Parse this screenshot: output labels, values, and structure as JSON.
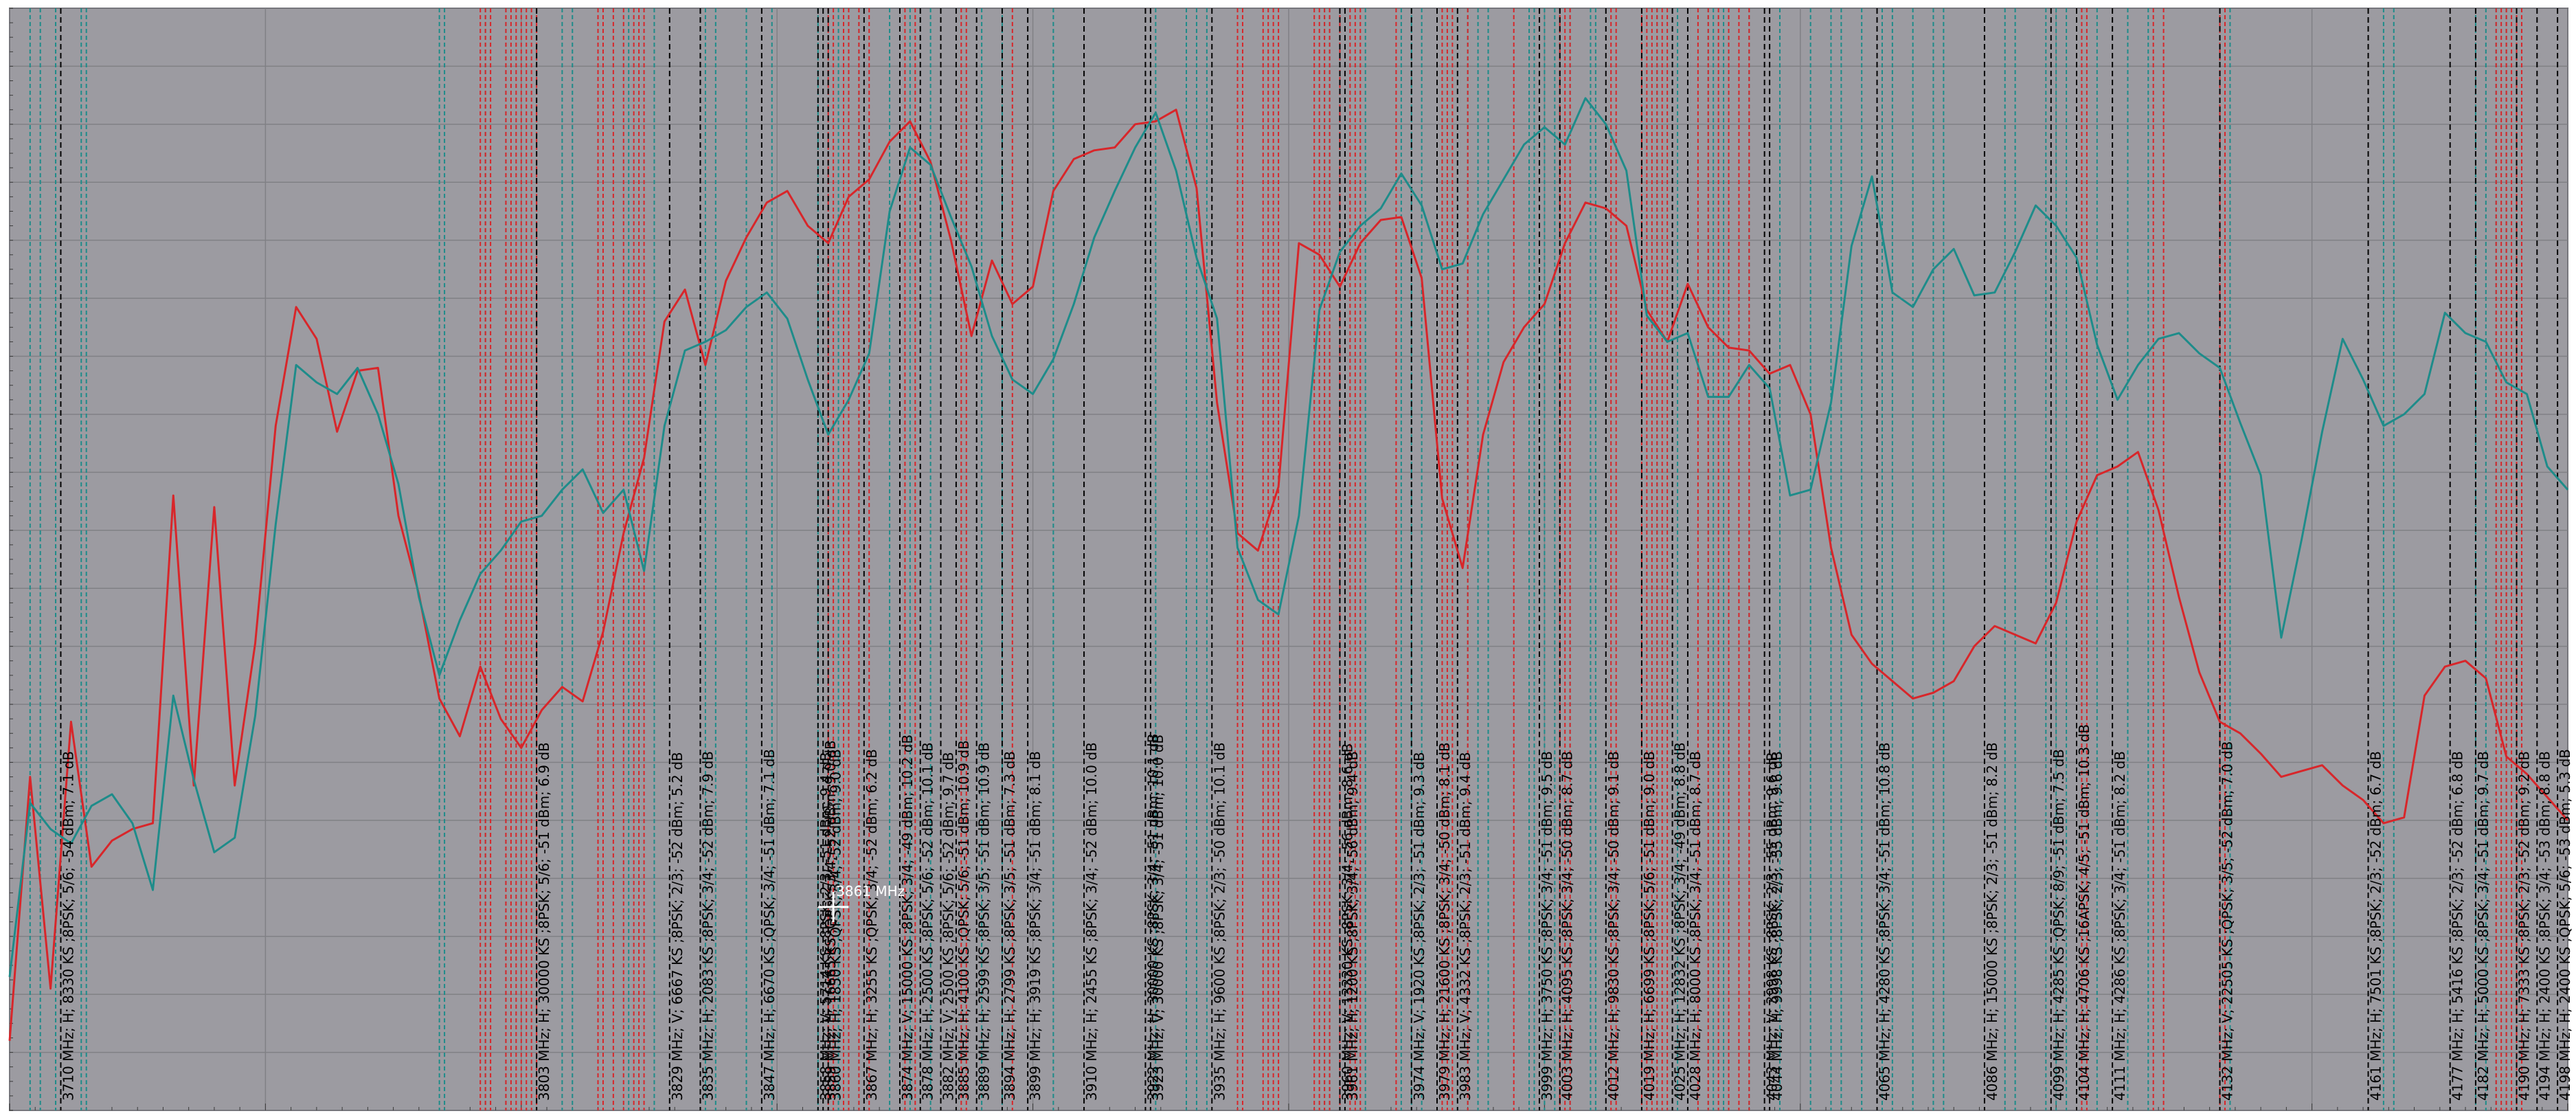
{
  "chart_data": {
    "type": "line",
    "title": "",
    "xlabel": "",
    "ylabel": "",
    "xlim": [
      3700,
      4200
    ],
    "ylim": [
      -82,
      -44
    ],
    "grid": true,
    "cursor": {
      "label": "3861 MHz",
      "freq": 3861
    },
    "colors": {
      "background": "#9c9ba1",
      "grid": "#808085",
      "series_h": "#d8262a",
      "series_v": "#1e8c8a",
      "marker_label": "#000000"
    },
    "series": [
      {
        "name": "",
        "color": "#d8262a",
        "x": [
          3700,
          3704,
          3708,
          3712,
          3716,
          3720,
          3724,
          3728,
          3732,
          3736,
          3740,
          3744,
          3748,
          3752,
          3756,
          3760,
          3764,
          3768,
          3772,
          3776,
          3780,
          3784,
          3788,
          3792,
          3796,
          3800,
          3804,
          3808,
          3812,
          3816,
          3820,
          3824,
          3828,
          3832,
          3836,
          3840,
          3844,
          3848,
          3852,
          3856,
          3860,
          3864,
          3868,
          3872,
          3876,
          3880,
          3884,
          3888,
          3892,
          3896,
          3900,
          3904,
          3908,
          3912,
          3916,
          3920,
          3924,
          3928,
          3932,
          3936,
          3940,
          3944,
          3948,
          3952,
          3956,
          3960,
          3964,
          3968,
          3972,
          3976,
          3980,
          3984,
          3988,
          3992,
          3996,
          4000,
          4004,
          4008,
          4012,
          4016,
          4020,
          4024,
          4028,
          4032,
          4036,
          4040,
          4044,
          4048,
          4052,
          4056,
          4060,
          4064,
          4068,
          4072,
          4076,
          4080,
          4084,
          4088,
          4092,
          4096,
          4100,
          4104,
          4108,
          4112,
          4116,
          4120,
          4124,
          4128,
          4132,
          4136,
          4140,
          4144,
          4148,
          4152,
          4156,
          4160,
          4164,
          4168,
          4172,
          4176,
          4180,
          4184,
          4188,
          4192,
          4196,
          4200
        ],
        "y": [
          -79.6,
          -70.5,
          -77.8,
          -68.6,
          -73.6,
          -72.7,
          -72.3,
          -72.1,
          -60.8,
          -70.8,
          -61.2,
          -70.8,
          -65.9,
          -58.4,
          -54.3,
          -55.4,
          -58.6,
          -56.5,
          -56.4,
          -61.5,
          -64.2,
          -67.8,
          -69.1,
          -66.7,
          -68.5,
          -69.5,
          -68.2,
          -67.4,
          -67.9,
          -65.5,
          -62.1,
          -59.5,
          -54.8,
          -53.7,
          -56.3,
          -53.4,
          -51.9,
          -50.7,
          -50.3,
          -51.5,
          -52.1,
          -50.5,
          -49.9,
          -48.6,
          -47.9,
          -49.3,
          -52.0,
          -55.3,
          -52.7,
          -54.2,
          -53.6,
          -50.3,
          -49.2,
          -48.9,
          -48.8,
          -48.0,
          -47.9,
          -47.5,
          -50.2,
          -57.6,
          -62.1,
          -62.7,
          -60.5,
          -52.1,
          -52.5,
          -53.6,
          -52.1,
          -51.3,
          -51.2,
          -53.3,
          -60.9,
          -63.3,
          -58.7,
          -56.2,
          -55.0,
          -54.2,
          -52.1,
          -50.7,
          -50.9,
          -51.5,
          -54.4,
          -55.5,
          -53.5,
          -55.0,
          -55.7,
          -55.8,
          -56.6,
          -56.3,
          -58.0,
          -62.6,
          -65.6,
          -66.6,
          -67.2,
          -67.8,
          -67.6,
          -67.2,
          -66.0,
          -65.3,
          -65.6,
          -65.9,
          -64.5,
          -61.7,
          -60.1,
          -59.8,
          -59.3,
          -61.3,
          -64.3,
          -66.9,
          -68.6,
          -69.0,
          -69.7,
          -70.5,
          -70.3,
          -70.1,
          -70.8,
          -71.3,
          -72.1,
          -71.9,
          -67.7,
          -66.7,
          -66.5,
          -67.1,
          -69.8,
          -70.4,
          -71.2,
          -72.0
        ]
      },
      {
        "name": "",
        "color": "#1e8c8a",
        "x": [
          3700,
          3704,
          3708,
          3712,
          3716,
          3720,
          3724,
          3728,
          3732,
          3736,
          3740,
          3744,
          3748,
          3752,
          3756,
          3760,
          3764,
          3768,
          3772,
          3776,
          3780,
          3784,
          3788,
          3792,
          3796,
          3800,
          3804,
          3808,
          3812,
          3816,
          3820,
          3824,
          3828,
          3832,
          3836,
          3840,
          3844,
          3848,
          3852,
          3856,
          3860,
          3864,
          3868,
          3872,
          3876,
          3880,
          3884,
          3888,
          3892,
          3896,
          3900,
          3904,
          3908,
          3912,
          3916,
          3920,
          3924,
          3928,
          3932,
          3936,
          3940,
          3944,
          3948,
          3952,
          3956,
          3960,
          3964,
          3968,
          3972,
          3976,
          3980,
          3984,
          3988,
          3992,
          3996,
          4000,
          4004,
          4008,
          4012,
          4016,
          4020,
          4024,
          4028,
          4032,
          4036,
          4040,
          4044,
          4048,
          4052,
          4056,
          4060,
          4064,
          4068,
          4072,
          4076,
          4080,
          4084,
          4088,
          4092,
          4096,
          4100,
          4104,
          4108,
          4112,
          4116,
          4120,
          4124,
          4128,
          4132,
          4136,
          4140,
          4144,
          4148,
          4152,
          4156,
          4160,
          4164,
          4168,
          4172,
          4176,
          4180,
          4184,
          4188,
          4192,
          4196,
          4200
        ],
        "y": [
          -77.4,
          -71.4,
          -72.3,
          -72.8,
          -71.5,
          -71.1,
          -72.1,
          -74.4,
          -67.7,
          -70.6,
          -73.1,
          -72.6,
          -68.4,
          -61.8,
          -56.3,
          -56.9,
          -57.3,
          -56.4,
          -58.0,
          -60.4,
          -64.3,
          -67.0,
          -65.1,
          -63.5,
          -62.7,
          -61.7,
          -61.5,
          -60.6,
          -59.9,
          -61.4,
          -60.6,
          -63.4,
          -58.4,
          -55.8,
          -55.5,
          -55.1,
          -54.3,
          -53.8,
          -54.7,
          -56.8,
          -58.7,
          -57.5,
          -55.9,
          -51.0,
          -48.8,
          -49.4,
          -51.2,
          -52.9,
          -55.3,
          -56.8,
          -57.3,
          -56.1,
          -54.2,
          -51.9,
          -50.3,
          -48.8,
          -47.6,
          -49.6,
          -52.6,
          -54.7,
          -62.6,
          -64.4,
          -64.9,
          -61.5,
          -54.4,
          -52.4,
          -51.5,
          -50.9,
          -49.7,
          -50.8,
          -53.0,
          -52.8,
          -51.1,
          -49.9,
          -48.7,
          -48.1,
          -48.7,
          -47.1,
          -48.0,
          -49.6,
          -54.6,
          -55.5,
          -55.2,
          -57.4,
          -57.4,
          -56.3,
          -57.1,
          -60.8,
          -60.6,
          -57.6,
          -52.2,
          -49.8,
          -53.8,
          -54.3,
          -53.0,
          -52.3,
          -53.9,
          -53.8,
          -52.4,
          -50.8,
          -51.5,
          -52.6,
          -55.6,
          -57.5,
          -56.3,
          -55.4,
          -55.2,
          -55.9,
          -56.4,
          -58.3,
          -60.1,
          -65.7,
          -62.3,
          -58.6,
          -55.4,
          -56.8,
          -58.4,
          -58.0,
          -57.3,
          -54.5,
          -55.2,
          -55.5,
          -56.9,
          -57.3,
          -59.8,
          -60.6
        ]
      }
    ],
    "markers": [
      {
        "freq": 3710,
        "pol": "H",
        "label": "3710 MHz; H; 8330 KS ;8PSK; 5/6; -54 dBm; 7.1 dB"
      },
      {
        "freq": 3803,
        "pol": "H",
        "label": "3803 MHz; H; 30000 KS ;8PSK; 5/6; -51 dBm; 6.9 dB"
      },
      {
        "freq": 3829,
        "pol": "V",
        "label": "3829 MHz; V; 6667 KS ;8PSK; 2/3; -52 dBm; 5.2 dB"
      },
      {
        "freq": 3835,
        "pol": "H",
        "label": "3835 MHz; H; 2083 KS ;8PSK; 3/4; -52 dBm; 7.9 dB"
      },
      {
        "freq": 3847,
        "pol": "H",
        "label": "3847 MHz; H; 6670 KS ;QPSK; 3/4; -51 dBm; 7.1 dB"
      },
      {
        "freq": 3858,
        "pol": "V",
        "label": "3858 MHz; V; 5714 KS ;8PSK; 2/3; -51 dBm; 9.4 dB"
      },
      {
        "freq": 3859,
        "pol": "H",
        "label": "3859 MHz; H; 16665 KS ;QPSK; 3/4; -52 dBm; 9.0 dB"
      },
      {
        "freq": 3860,
        "pol": "H",
        "label": "3860 MHz; H; 1850 KS ;QPSK; 3/4; -52 dBm; 9.0 dB"
      },
      {
        "freq": 3867,
        "pol": "H",
        "label": "3867 MHz; H; 3255 KS ;QPSK; 3/4; -52 dBm; 6.2 dB"
      },
      {
        "freq": 3874,
        "pol": "V",
        "label": "3874 MHz; V; 15000 KS ;8PSK; 3/4; -49 dBm; 10.2 dB"
      },
      {
        "freq": 3878,
        "pol": "H",
        "label": "3878 MHz; H; 2500 KS ;8PSK; 5/6; -52 dBm; 10.1 dB"
      },
      {
        "freq": 3882,
        "pol": "V",
        "label": "3882 MHz; V; 2500 KS ;8PSK; 5/6; -52 dBm; 9.7 dB"
      },
      {
        "freq": 3885,
        "pol": "H",
        "label": "3885 MHz; H; 4100 KS ;QPSK; 5/6; -51 dBm; 10.9 dB"
      },
      {
        "freq": 3889,
        "pol": "H",
        "label": "3889 MHz; H; 2599 KS ;8PSK; 3/5; -51 dBm; 10.9 dB"
      },
      {
        "freq": 3894,
        "pol": "H",
        "label": "3894 MHz; H; 2799 KS ;8PSK; 3/5; -51 dBm; 7.3 dB"
      },
      {
        "freq": 3899,
        "pol": "H",
        "label": "3899 MHz; H; 3919 KS ;8PSK; 3/4; -51 dBm; 8.1 dB"
      },
      {
        "freq": 3910,
        "pol": "H",
        "label": "3910 MHz; H; 2455 KS ;8PSK; 3/4; -52 dBm; 10.0 dB"
      },
      {
        "freq": 3922,
        "pol": "H",
        "label": "3922 MHz; H; 30000 KS ;8PSK; 3/4; -51 dBm; 10.1 dB"
      },
      {
        "freq": 3923,
        "pol": "V",
        "label": "3923 MHz; V; 30000 KS ;8PSK; 3/4; -51 dBm; 10.0 dB"
      },
      {
        "freq": 3935,
        "pol": "H",
        "label": "3935 MHz; H; 9600 KS ;8PSK; 2/3; -50 dBm; 10.1 dB"
      },
      {
        "freq": 3960,
        "pol": "V",
        "label": "3960 MHz; V; 13330 KS ;8PSK; 3/4; -56 dBm; 8.6 dB"
      },
      {
        "freq": 3961,
        "pol": "H",
        "label": "3961 MHz; H; 1200 KS ;8PSK; 3/4; -56 dBm; 9.4 dB"
      },
      {
        "freq": 3974,
        "pol": "V",
        "label": "3974 MHz; V; 1920 KS ;8PSK; 2/3; -51 dBm; 9.3 dB"
      },
      {
        "freq": 3979,
        "pol": "H",
        "label": "3979 MHz; H; 21600 KS ;8PSK; 3/4; -50 dBm; 8.1 dB"
      },
      {
        "freq": 3983,
        "pol": "V",
        "label": "3983 MHz; V; 4332 KS ;8PSK; 2/3; -51 dBm; 9.4 dB"
      },
      {
        "freq": 3999,
        "pol": "H",
        "label": "3999 MHz; H; 3750 KS ;8PSK; 3/4; -51 dBm; 9.5 dB"
      },
      {
        "freq": 4003,
        "pol": "H",
        "label": "4003 MHz; H; 4095 KS ;8PSK; 3/4; -50 dBm; 8.7 dB"
      },
      {
        "freq": 4012,
        "pol": "H",
        "label": "4012 MHz; H; 9830 KS ;8PSK; 3/4; -50 dBm; 9.1 dB"
      },
      {
        "freq": 4019,
        "pol": "H",
        "label": "4019 MHz; H; 6699 KS ;8PSK; 5/6; -51 dBm; 9.0 dB"
      },
      {
        "freq": 4025,
        "pol": "H",
        "label": "4025 MHz; H; 12832 KS ;8PSK; 3/4; -49 dBm; 8.8 dB"
      },
      {
        "freq": 4028,
        "pol": "H",
        "label": "4028 MHz; H; 8000 KS ;8PSK; 3/4; -51 dBm; 8.7 dB"
      },
      {
        "freq": 4043,
        "pol": "V",
        "label": "4043 MHz; V; 3998 KS ;8PSK; 2/3; -55 dBm; 9.6 dB"
      },
      {
        "freq": 4044,
        "pol": "H",
        "label": "4044 MHz; H; 9998 KS ;8PSK; 2/3; -55 dBm; 9.6 dB"
      },
      {
        "freq": 4065,
        "pol": "H",
        "label": "4065 MHz; H; 4280 KS ;8PSK; 3/4; -51 dBm; 10.8 dB"
      },
      {
        "freq": 4086,
        "pol": "H",
        "label": "4086 MHz; H; 15000 KS ;8PSK; 2/3; -51 dBm; 8.2 dB"
      },
      {
        "freq": 4099,
        "pol": "H",
        "label": "4099 MHz; H; 4285 KS ;QPSK; 8/9; -51 dBm; 7.5 dB"
      },
      {
        "freq": 4104,
        "pol": "H",
        "label": "4104 MHz; H; 4706 KS ;16APSK; 4/5; -51 dBm; 10.3 dB"
      },
      {
        "freq": 4111,
        "pol": "H",
        "label": "4111 MHz; H; 4286 KS ;8PSK; 3/4; -51 dBm; 8.2 dB"
      },
      {
        "freq": 4132,
        "pol": "V",
        "label": "4132 MHz; V; 22505 KS ;QPSK; 3/5; -52 dBm; 7.0 dB"
      },
      {
        "freq": 4161,
        "pol": "H",
        "label": "4161 MHz; H; 7501 KS ;8PSK; 2/3; -52 dBm; 6.7 dB"
      },
      {
        "freq": 4177,
        "pol": "H",
        "label": "4177 MHz; H; 5416 KS ;8PSK; 2/3; -52 dBm; 6.8 dB"
      },
      {
        "freq": 4182,
        "pol": "H",
        "label": "4182 MHz; H; 5000 KS ;8PSK; 3/4; -51 dBm; 9.7 dB"
      },
      {
        "freq": 4190,
        "pol": "H",
        "label": "4190 MHz; H; 7333 KS ;8PSK; 2/3; -52 dBm; 9.2 dB"
      },
      {
        "freq": 4194,
        "pol": "H",
        "label": "4194 MHz; H; 2400 KS ;8PSK; 3/4; -53 dBm; 8.8 dB"
      },
      {
        "freq": 4198,
        "pol": "H",
        "label": "4198 MHz; H; 2400 KS ;QPSK; 5/6; -53 dBm; 5.3 dB"
      }
    ],
    "red_lines": [
      3792,
      3793,
      3794,
      3797,
      3798,
      3799,
      3800,
      3801,
      3802,
      3803,
      3815,
      3816,
      3818,
      3820,
      3822,
      3823,
      3824,
      3860,
      3861,
      3863,
      3864,
      3866,
      3868,
      3875,
      3877,
      3886,
      3887,
      3896,
      3940,
      3941,
      3945,
      3946,
      3947,
      3948,
      3955,
      3956,
      3957,
      3958,
      3960,
      3962,
      3963,
      3964,
      3971,
      3980,
      3981,
      3982,
      3985,
      3994,
      4003,
      4004,
      4005,
      4013,
      4014,
      4019,
      4020,
      4021,
      4022,
      4023,
      4024,
      4030,
      4032,
      4034,
      4036,
      4038,
      4040,
      4105,
      4106,
      4119,
      4121,
      4132,
      4133,
      4186,
      4187,
      4188,
      4189,
      4190,
      4191
    ],
    "teal_lines": [
      3704,
      3706,
      3709,
      3714,
      3715,
      3784,
      3785,
      3793,
      3797,
      3808,
      3810,
      3821,
      3826,
      3836,
      3838,
      3844,
      3849,
      3858,
      3862,
      3864,
      3866,
      3872,
      3876,
      3880,
      3890,
      3894,
      3904,
      3924,
      3930,
      3932,
      3934,
      3957,
      3958,
      3960,
      3965,
      3972,
      3974,
      3976,
      3985,
      3987,
      3989,
      3997,
      3998,
      4000,
      4002,
      4003,
      4005,
      4009,
      4010,
      4022,
      4026,
      4032,
      4033,
      4035,
      4036,
      4040,
      4046,
      4052,
      4056,
      4058,
      4062,
      4066,
      4068,
      4072,
      4076,
      4078,
      4090,
      4092,
      4098,
      4100,
      4102,
      4108,
      4114,
      4118,
      4132,
      4134,
      4164,
      4166,
      4182,
      4184,
      4186,
      4188
    ]
  }
}
